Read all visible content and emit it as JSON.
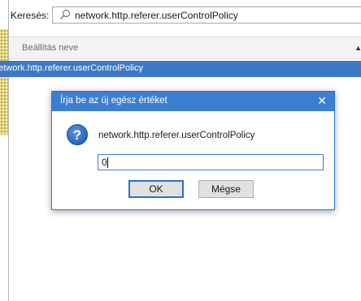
{
  "search": {
    "label": "Keresés:",
    "value": "network.http.referer.userControlPolicy",
    "icon": "search-icon"
  },
  "table": {
    "column_header": "Beállítás neve",
    "sort_indicator": "▲",
    "selected_row": "network.http.referer.userControlPolicy"
  },
  "dialog": {
    "title": "Írja be az új egész értéket",
    "close": "✕",
    "message": "network.http.referer.userControlPolicy",
    "input_value": "0",
    "ok_label": "OK",
    "cancel_label": "Mégse",
    "icon": "question-icon"
  },
  "colors": {
    "selection": "#3d78c4",
    "dialog_title": "#3c7fd1",
    "question_icon": "#1f5fb4"
  }
}
